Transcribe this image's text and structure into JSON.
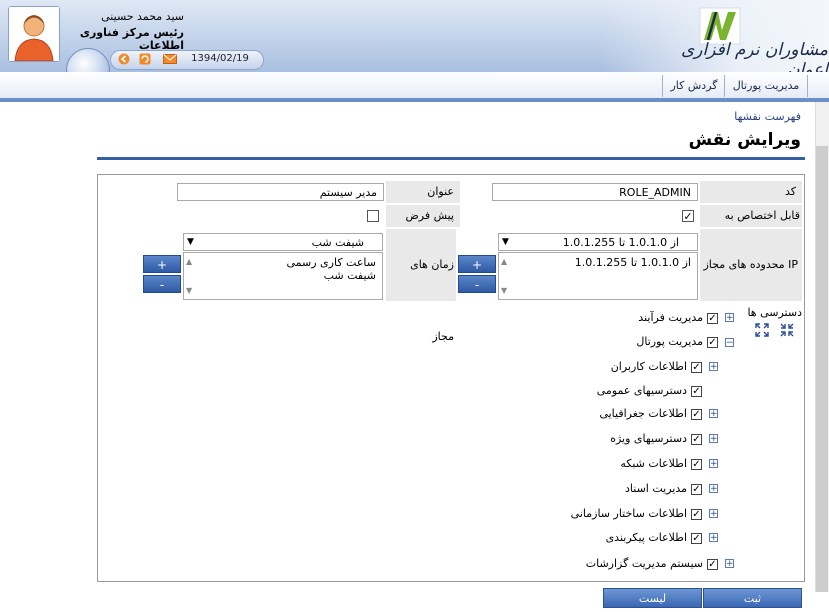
{
  "header": {
    "user_name": "سید محمد حسینی",
    "user_title": "رئیس مرکز فناوری اطلاعات",
    "date": "1394/02/19",
    "brand_name": "مشاوران نرم افزاری اعوان",
    "icons": [
      "back-icon",
      "refresh-icon",
      "mail-icon"
    ]
  },
  "nav": {
    "tabs": [
      "مدیریت پورتال",
      "گردش کار"
    ]
  },
  "page": {
    "breadcrumb": "فهرست نقشها",
    "title": "ویرایش نقش"
  },
  "form": {
    "code_label": "کد",
    "code_value": "ROLE_ADMIN",
    "title_label": "عنوان",
    "title_value": "مدیر سیستم",
    "assignable_label": "قابل اختصاص به کاربر",
    "assignable_checked": true,
    "default_label": "پیش فرض",
    "default_checked": false,
    "ip_label": "محدوده های مجاز IP",
    "ip_select": "از 1.0.1.0 تا 1.0.1.255",
    "ip_list": [
      "از 1.0.1.0 تا 1.0.1.255"
    ],
    "time_label": "زمان های مجاز",
    "time_select": "شیفت شب",
    "time_list": [
      "ساعت کاری رسمی",
      "شیفت شب"
    ],
    "add_label": "+",
    "remove_label": "-",
    "access_label": "دسترسی ها"
  },
  "tree": [
    {
      "label": "مدیریت فرآیند",
      "checked": true,
      "expander": "plus"
    },
    {
      "label": "مدیریت پورتال",
      "checked": true,
      "expander": "minus"
    },
    {
      "label": "اطلاعات کاربران",
      "checked": true,
      "expander": "plus"
    },
    {
      "label": "دسترسیهای عمومی",
      "checked": true,
      "expander": "none"
    },
    {
      "label": "اطلاعات جغرافیایی",
      "checked": true,
      "expander": "plus"
    },
    {
      "label": "دسترسیهای ویژه",
      "checked": true,
      "expander": "plus"
    },
    {
      "label": "اطلاعات شبکه",
      "checked": true,
      "expander": "plus"
    },
    {
      "label": "مدیریت اسناد",
      "checked": true,
      "expander": "plus"
    },
    {
      "label": "اطلاعات ساختار سازمانی",
      "checked": true,
      "expander": "plus"
    },
    {
      "label": "اطلاعات پیکربندی",
      "checked": true,
      "expander": "plus"
    },
    {
      "label": "سیستم مدیریت گزارشات",
      "checked": true,
      "expander": "plus"
    }
  ],
  "buttons": {
    "submit": "ثبت",
    "list": "لیست"
  },
  "colors": {
    "accent": "#345ea7",
    "button": "#3a67b3"
  }
}
